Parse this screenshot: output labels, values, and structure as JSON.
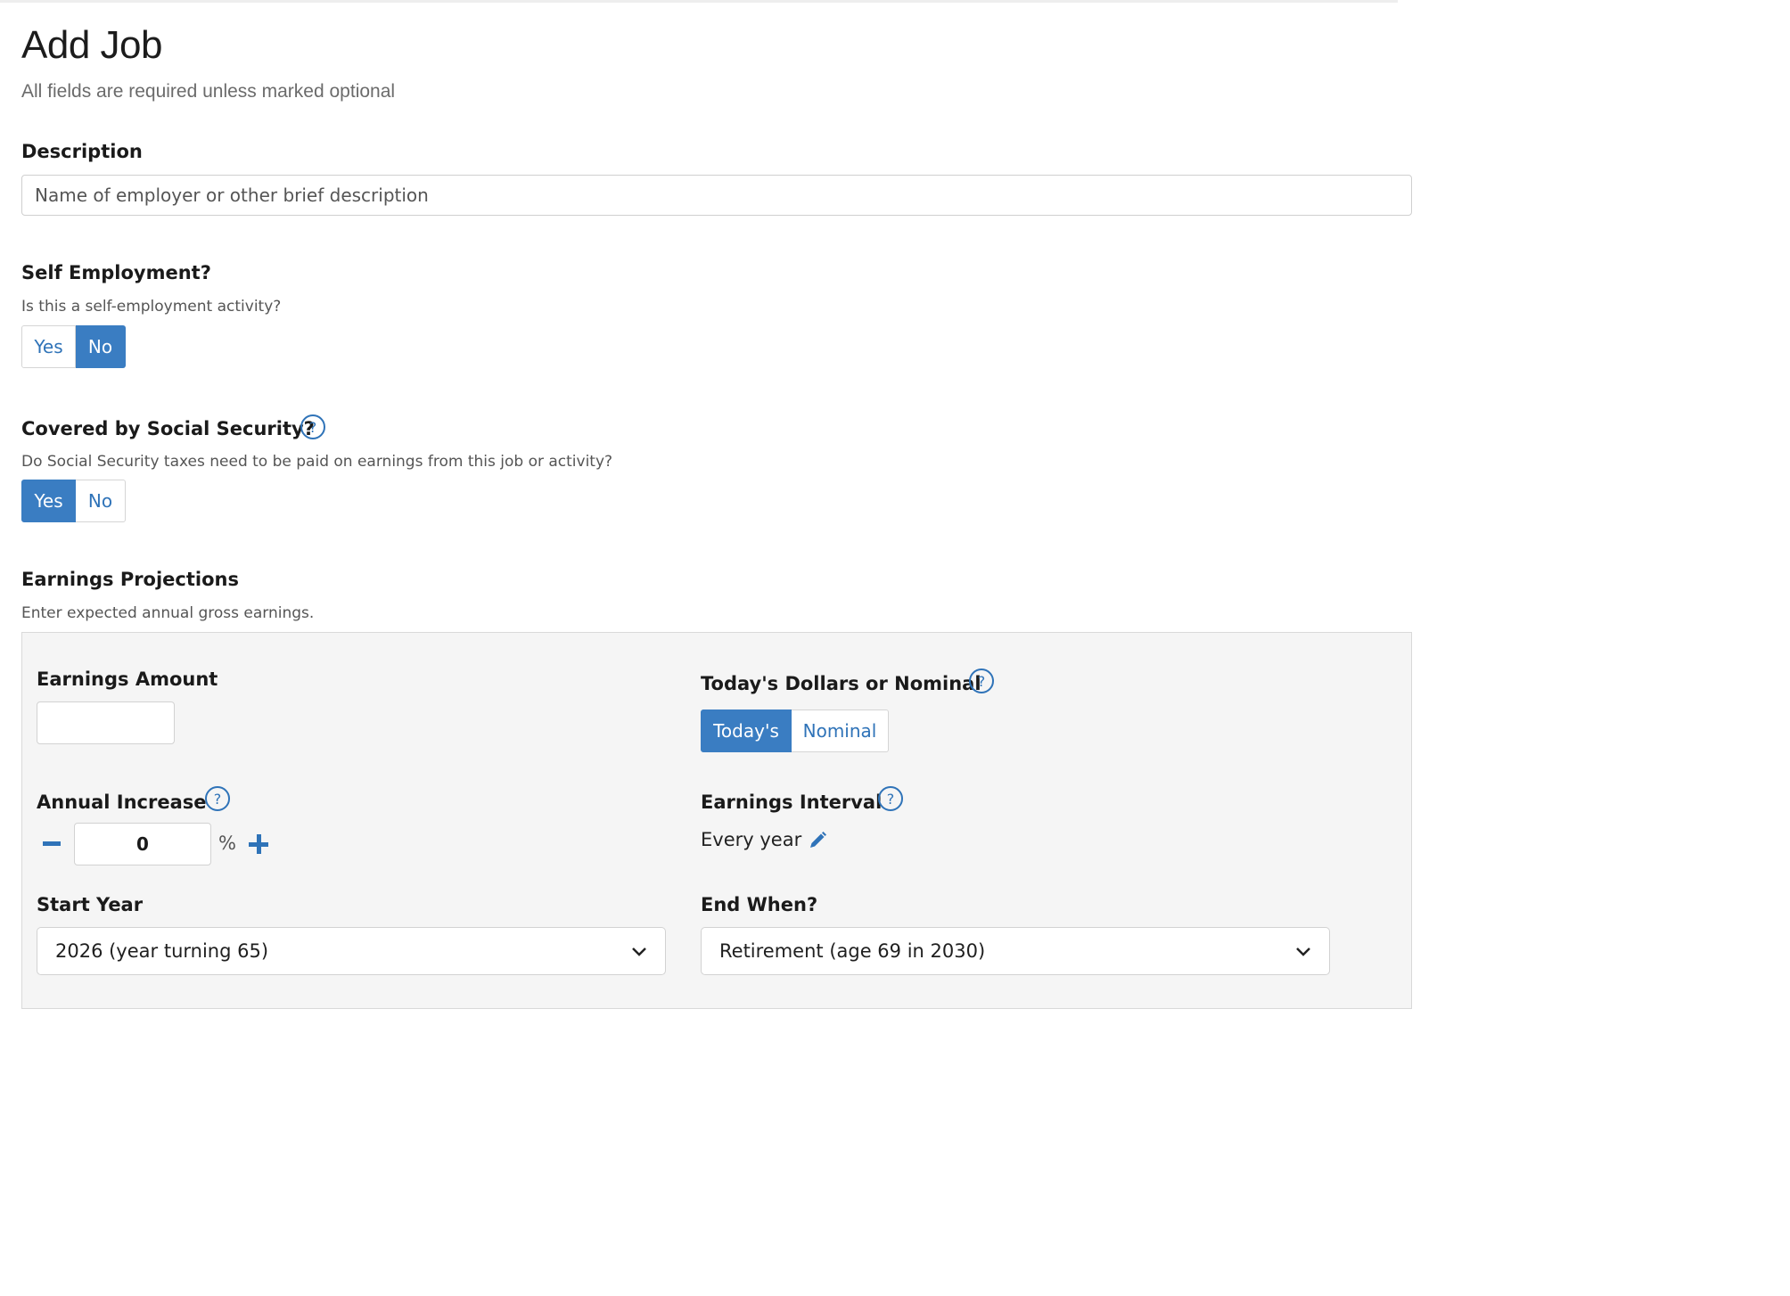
{
  "header": {
    "title": "Add Job",
    "subtitle": "All fields are required unless marked optional"
  },
  "description": {
    "label": "Description",
    "placeholder": "Name of employer or other brief description",
    "value": ""
  },
  "self_employment": {
    "label": "Self Employment?",
    "hint": "Is this a self-employment activity?",
    "options": [
      "Yes",
      "No"
    ],
    "selected": "No"
  },
  "social_security": {
    "label": "Covered by Social Security?",
    "hint": "Do Social Security taxes need to be paid on earnings from this job or activity?",
    "options": [
      "Yes",
      "No"
    ],
    "selected": "Yes",
    "help_icon": "help-circle-icon"
  },
  "earnings_projections": {
    "label": "Earnings Projections",
    "hint": "Enter expected annual gross earnings.",
    "earnings_amount": {
      "label": "Earnings Amount",
      "value": ""
    },
    "dollars_type": {
      "label": "Today's Dollars or Nominal",
      "options": [
        "Today's",
        "Nominal"
      ],
      "selected": "Today's"
    },
    "annual_increase": {
      "label": "Annual Increase",
      "value": "0",
      "unit": "%",
      "decrement_icon": "minus-icon",
      "increment_icon": "plus-icon"
    },
    "earnings_interval": {
      "label": "Earnings Interval",
      "value": "Every year",
      "edit_icon": "pencil-icon"
    },
    "start_year": {
      "label": "Start Year",
      "selected": "2026 (year turning 65)"
    },
    "end_when": {
      "label": "End When?",
      "selected": "Retirement (age 69 in 2030)"
    }
  },
  "colors": {
    "accent": "#3a7dc2",
    "link": "#2f73b8",
    "panel_bg": "#f5f5f5"
  }
}
